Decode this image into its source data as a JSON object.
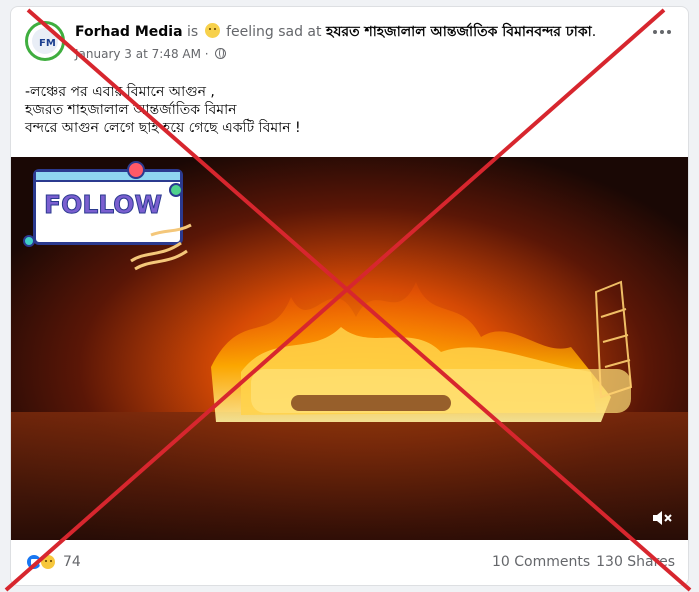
{
  "post": {
    "author": "Forhad Media",
    "is_text": "is",
    "feeling_text": "feeling sad at",
    "place": "হযরত শাহজালাল আন্তর্জাতিক বিমানবন্দর ঢাকা",
    "place_suffix": ".",
    "timestamp": "January 3 at 7:48 AM",
    "separator": "·",
    "text_lines": [
      "-লঞ্চের পর এবার বিমানে  আগুন ,",
      "হজরত শাহজালাল আন্তর্জাতিক বিমান",
      "বন্দরে আগুন লেগে ছাই হয়ে গেছে একটি বিমান !"
    ],
    "sticker_text": "FOLLOW",
    "avatar_text": "FM"
  },
  "icons": {
    "avatar": "avatar-icon",
    "feeling": "sad-emoji-icon",
    "audience": "globe-icon",
    "more": "more-options-icon",
    "volume": "volume-mute-icon",
    "like": "like-reaction-icon",
    "sad": "sad-reaction-icon"
  },
  "footer": {
    "reactions_count": "74",
    "comments": "10 Comments",
    "shares": "130 Shares"
  },
  "colors": {
    "fact_check_cross": "#d7262e",
    "fire": "#ff7a00",
    "like_blue": "#1877f2"
  }
}
